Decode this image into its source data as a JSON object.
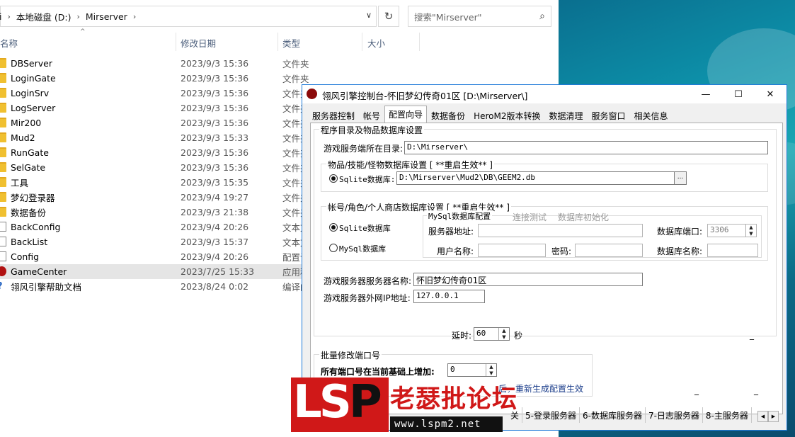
{
  "explorer": {
    "breadcrumb": {
      "edge": "i",
      "drive": "本地磁盘 (D:)",
      "folder": "Mirserver"
    },
    "search_placeholder": "搜索\"Mirserver\"",
    "columns": {
      "name": "名称",
      "date": "修改日期",
      "type": "类型",
      "size": "大小"
    },
    "files": [
      {
        "name": "DBServer",
        "date": "2023/9/3 15:36",
        "type": "文件夹",
        "icon": "folder-icon"
      },
      {
        "name": "LoginGate",
        "date": "2023/9/3 15:36",
        "type": "文件夹",
        "icon": "folder-icon"
      },
      {
        "name": "LoginSrv",
        "date": "2023/9/3 15:36",
        "type": "文件夹",
        "icon": "folder-icon"
      },
      {
        "name": "LogServer",
        "date": "2023/9/3 15:36",
        "type": "文件夹",
        "icon": "folder-icon"
      },
      {
        "name": "Mir200",
        "date": "2023/9/3 15:36",
        "type": "文件夹",
        "icon": "folder-icon"
      },
      {
        "name": "Mud2",
        "date": "2023/9/3 15:33",
        "type": "文件夹",
        "icon": "folder-icon"
      },
      {
        "name": "RunGate",
        "date": "2023/9/3 15:36",
        "type": "文件夹",
        "icon": "folder-icon"
      },
      {
        "name": "SelGate",
        "date": "2023/9/3 15:36",
        "type": "文件夹",
        "icon": "folder-icon"
      },
      {
        "name": "工具",
        "date": "2023/9/3 15:35",
        "type": "文件夹",
        "icon": "folder-icon"
      },
      {
        "name": "梦幻登录器",
        "date": "2023/9/4 19:27",
        "type": "文件夹",
        "icon": "folder-icon"
      },
      {
        "name": "数据备份",
        "date": "2023/9/3 21:38",
        "type": "文件夹",
        "icon": "folder-icon"
      },
      {
        "name": "BackConfig",
        "date": "2023/9/4 20:26",
        "type": "文本文",
        "icon": "text-file-icon"
      },
      {
        "name": "BackList",
        "date": "2023/9/3 15:37",
        "type": "文本文",
        "icon": "text-file-icon"
      },
      {
        "name": "Config",
        "date": "2023/9/4 20:26",
        "type": "配置设",
        "icon": "config-file-icon"
      },
      {
        "name": "GameCenter",
        "date": "2023/7/25 15:33",
        "type": "应用程",
        "icon": "app-icon"
      },
      {
        "name": "翎风引擎帮助文档",
        "date": "2023/8/24 0:02",
        "type": "编译的",
        "icon": "help-file-icon"
      }
    ]
  },
  "window": {
    "title": "翎风引擎控制台-怀旧梦幻传奇01区 [D:\\Mirserver\\]",
    "tabs": [
      "服务器控制",
      "帐号",
      "配置向导",
      "数据备份",
      "HeroM2版本转换",
      "数据清理",
      "服务窗口",
      "相关信息"
    ],
    "active_tab": "配置向导",
    "section_title": "程序目录及物品数据库设置",
    "game_dir_label": "游戏服务端所在目录:",
    "game_dir_value": "D:\\Mirserver\\",
    "item_db_group": "物品/技能/怪物数据库设置 [ **重启生效** ]",
    "sqlite_item_label": "Sqlite数据库:",
    "sqlite_item_path": "D:\\Mirserver\\Mud2\\DB\\GEEM2.db",
    "browse_label": "...",
    "account_db_group": "帐号/角色/个人商店数据库设置 [ **重启生效** ]",
    "sqlite_account_label": "Sqlite数据库",
    "mysql_label": "MySql数据库",
    "mysql_group": "MySql数据库配置",
    "test_conn": "连接测试",
    "init_db": "数据库初始化",
    "server_addr_label": "服务器地址:",
    "db_port_label": "数据库端口:",
    "db_port_value": "3306",
    "user_label": "用户名称:",
    "password_label": "密码:",
    "db_name_label": "数据库名称:",
    "server_name_label": "游戏服务器服务器名称:",
    "server_name_value": "怀旧梦幻传奇01区",
    "server_ip_label": "游戏服务器外网IP地址:",
    "server_ip_value": "127.0.0.1",
    "delay_label": "延时:",
    "delay_value": "60",
    "delay_unit": "秒",
    "batch_group": "批量修改端口号",
    "port_inc_label": "所有端口号在当前基础上增加:",
    "port_inc_value": "0",
    "regen_note": "后，重新生成配置生效",
    "bottom_tabs": [
      "关",
      "5-登录服务器",
      "6-数据库服务器",
      "7-日志服务器",
      "8-主服务器"
    ]
  },
  "watermark": {
    "brand": "LSP",
    "cn": "老瑟批论坛",
    "url": "www.lspm2.net"
  }
}
